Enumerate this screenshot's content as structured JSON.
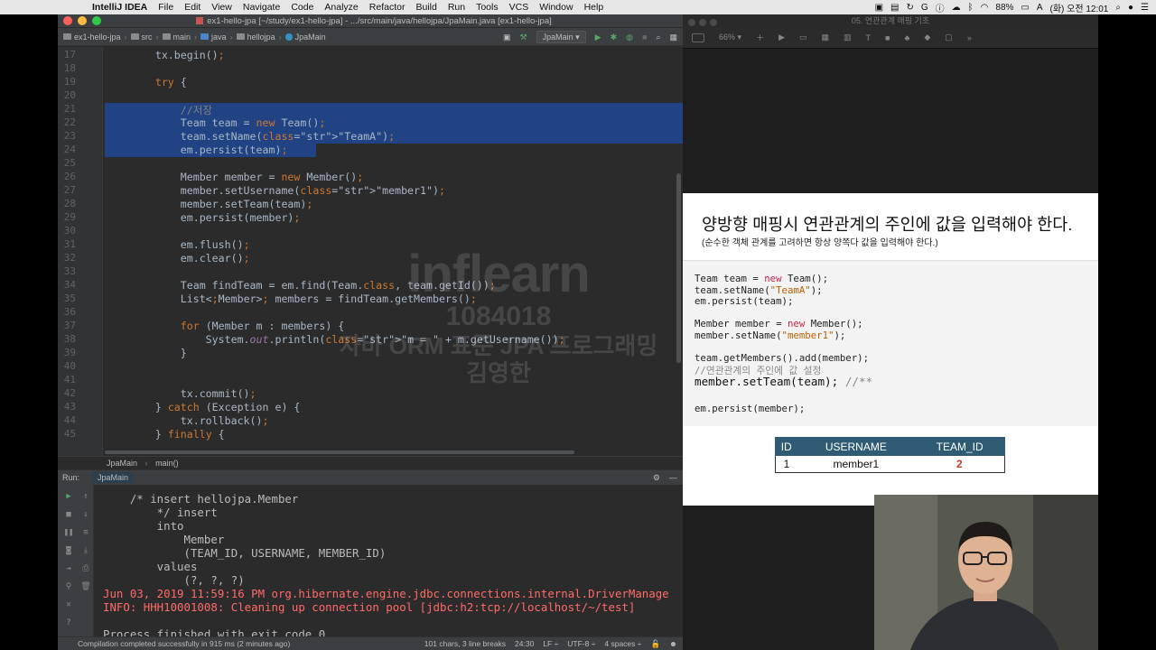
{
  "menubar": {
    "app_name": "IntelliJ IDEA",
    "items": [
      "File",
      "Edit",
      "View",
      "Navigate",
      "Code",
      "Analyze",
      "Refactor",
      "Build",
      "Run",
      "Tools",
      "VCS",
      "Window",
      "Help"
    ],
    "battery": "88%",
    "datetime": "(화) 오전 12:01"
  },
  "ide": {
    "window_title": "ex1-hello-jpa [~/study/ex1-hello-jpa] - .../src/main/java/hellojpa/JpaMain.java [ex1-hello-jpa]",
    "breadcrumbs": [
      "ex1-hello-jpa",
      "src",
      "main",
      "java",
      "hellojpa",
      "JpaMain"
    ],
    "run_config": "JpaMain",
    "editor_lines": [
      {
        "n": "17",
        "code": "        tx.begin();"
      },
      {
        "n": "18",
        "code": ""
      },
      {
        "n": "19",
        "code": "        try {"
      },
      {
        "n": "20",
        "code": ""
      },
      {
        "n": "21",
        "code": "            //저장"
      },
      {
        "n": "22",
        "code": "            Team team = new Team();"
      },
      {
        "n": "23",
        "code": "            team.setName(\"TeamA\");"
      },
      {
        "n": "24",
        "code": "            em.persist(team);"
      },
      {
        "n": "25",
        "code": ""
      },
      {
        "n": "26",
        "code": "            Member member = new Member();"
      },
      {
        "n": "27",
        "code": "            member.setUsername(\"member1\");"
      },
      {
        "n": "28",
        "code": "            member.setTeam(team);"
      },
      {
        "n": "29",
        "code": "            em.persist(member);"
      },
      {
        "n": "30",
        "code": ""
      },
      {
        "n": "31",
        "code": "            em.flush();"
      },
      {
        "n": "32",
        "code": "            em.clear();"
      },
      {
        "n": "33",
        "code": ""
      },
      {
        "n": "34",
        "code": "            Team findTeam = em.find(Team.class, team.getId());"
      },
      {
        "n": "35",
        "code": "            List<Member> members = findTeam.getMembers();"
      },
      {
        "n": "36",
        "code": ""
      },
      {
        "n": "37",
        "code": "            for (Member m : members) {"
      },
      {
        "n": "38",
        "code": "                System.out.println(\"m = \" + m.getUsername());"
      },
      {
        "n": "39",
        "code": "            }"
      },
      {
        "n": "40",
        "code": ""
      },
      {
        "n": "41",
        "code": ""
      },
      {
        "n": "42",
        "code": "            tx.commit();"
      },
      {
        "n": "43",
        "code": "        } catch (Exception e) {"
      },
      {
        "n": "44",
        "code": "            tx.rollback();"
      },
      {
        "n": "45",
        "code": "        } finally {"
      }
    ],
    "editor_breadcrumb": [
      "JpaMain",
      "main()"
    ],
    "run_label": "Run:",
    "run_tab": "JpaMain",
    "console_lines": [
      {
        "text": "    /* insert hellojpa.Member",
        "cls": ""
      },
      {
        "text": "        */ insert",
        "cls": ""
      },
      {
        "text": "        into",
        "cls": ""
      },
      {
        "text": "            Member",
        "cls": ""
      },
      {
        "text": "            (TEAM_ID, USERNAME, MEMBER_ID)",
        "cls": ""
      },
      {
        "text": "        values",
        "cls": ""
      },
      {
        "text": "            (?, ?, ?)",
        "cls": ""
      },
      {
        "text": "Jun 03, 2019 11:59:16 PM org.hibernate.engine.jdbc.connections.internal.DriverManage",
        "cls": "cred"
      },
      {
        "text": "INFO: HHH10001008: Cleaning up connection pool [jdbc:h2:tcp://localhost/~/test]",
        "cls": "cred"
      },
      {
        "text": "",
        "cls": ""
      },
      {
        "text": "Process finished with exit code 0",
        "cls": ""
      }
    ],
    "status_left": "Compilation completed successfully in 915 ms (2 minutes ago)",
    "status_right": [
      "101 chars, 3 line breaks",
      "24:30",
      "LF ÷",
      "UTF-8 ÷",
      "4 spaces ÷"
    ]
  },
  "watermark": {
    "brand": "inflearn",
    "number": "1084018",
    "course": "자바 ORM 표준 JPA 프로그래밍",
    "author": "김영한"
  },
  "keynote": {
    "window_title": "05. 연관관계 매핑 기초",
    "zoom": "66%",
    "slide_title": "양방향 매핑시 연관관계의 주인에 값을 입력해야 한다.",
    "slide_subtitle": "(순수한 객체 관계를 고려하면 항상 양쪽다 값을 입력해야 한다.)",
    "code_lines": [
      "Team team = new Team();",
      "team.setName(\"TeamA\");",
      "em.persist(team);",
      "",
      "Member member = new Member();",
      "member.setName(\"member1\");",
      "",
      "team.getMembers().add(member);",
      "//연관관계의 주인에 값 설정",
      "member.setTeam(team); //**",
      "",
      "em.persist(member);"
    ],
    "table": {
      "headers": [
        "ID",
        "USERNAME",
        "TEAM_ID"
      ],
      "rows": [
        [
          "1",
          "member1",
          "2"
        ]
      ]
    }
  }
}
